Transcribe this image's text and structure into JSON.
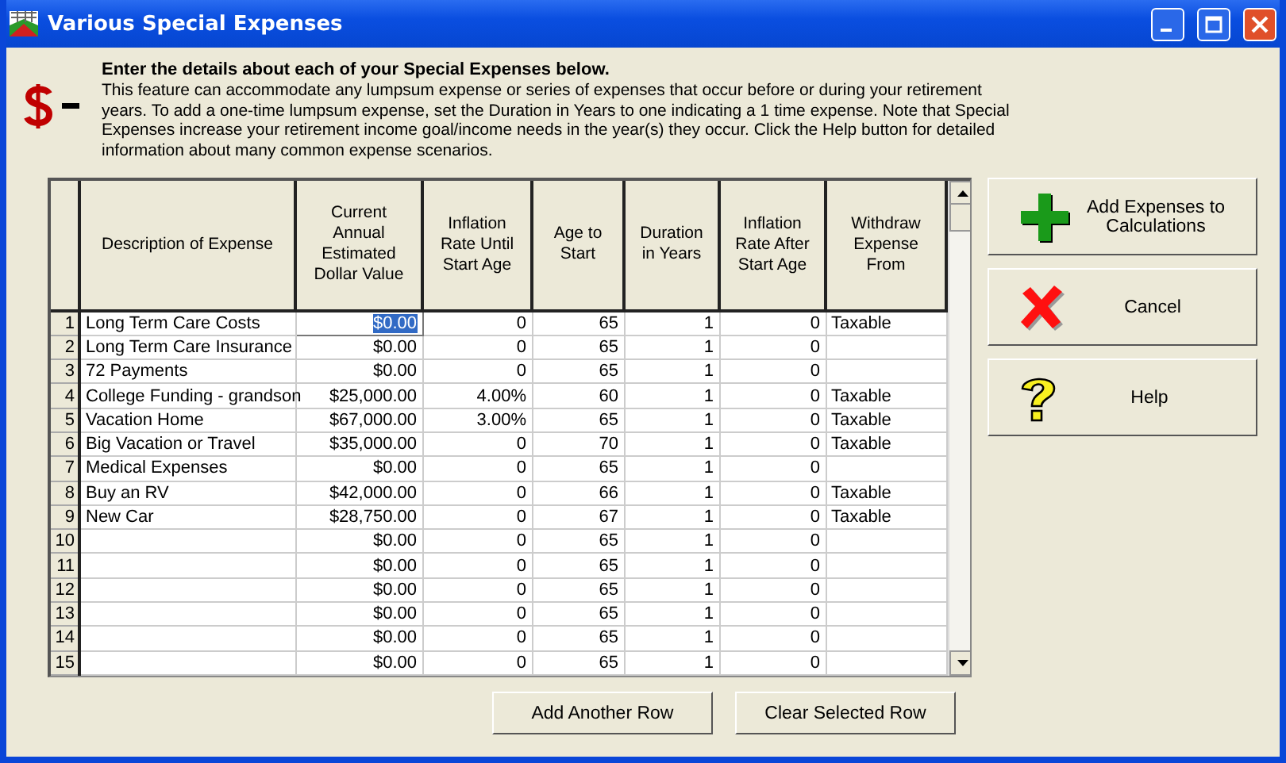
{
  "window": {
    "title": "Various Special Expenses"
  },
  "intro": {
    "heading": "Enter the details about each of your Special Expenses below.",
    "text": "This feature can accommodate any lumpsum expense or series of expenses that occur before or during your retirement years.  To add a one-time lumpsum expense, set the Duration in Years to one indicating a 1 time expense.  Note that Special Expenses increase your retirement income goal/income needs in the year(s) they occur.  Click the Help button for detailed information about many common expense scenarios."
  },
  "table": {
    "columns": [
      "Description of Expense",
      "Current Annual Estimated Dollar Value",
      "Inflation Rate Until Start Age",
      "Age to Start",
      "Duration in Years",
      "Inflation Rate After Start Age",
      "Withdraw Expense From"
    ],
    "rows": [
      {
        "number": "1",
        "description": "Long Term Care Costs",
        "dollar_value": "$0.00",
        "inflation_until_start": "0",
        "age_to_start": "65",
        "duration_years": "1",
        "inflation_after_start": "0",
        "withdraw_from": "Taxable",
        "selected": true
      },
      {
        "number": "2",
        "description": "Long Term Care Insurance",
        "dollar_value": "$0.00",
        "inflation_until_start": "0",
        "age_to_start": "65",
        "duration_years": "1",
        "inflation_after_start": "0",
        "selected": false
      },
      {
        "number": "3",
        "description": "72 Payments",
        "dollar_value": "$0.00",
        "inflation_until_start": "0",
        "age_to_start": "65",
        "duration_years": "1",
        "inflation_after_start": "0",
        "selected": false
      },
      {
        "number": "4",
        "description": "College Funding - grandson",
        "dollar_value": "$25,000.00",
        "inflation_until_start": "4.00%",
        "age_to_start": "60",
        "duration_years": "1",
        "inflation_after_start": "0",
        "withdraw_from": "Taxable",
        "selected": false
      },
      {
        "number": "5",
        "description": "Vacation Home",
        "dollar_value": "$67,000.00",
        "inflation_until_start": "3.00%",
        "age_to_start": "65",
        "duration_years": "1",
        "inflation_after_start": "0",
        "withdraw_from": "Taxable",
        "selected": false
      },
      {
        "number": "6",
        "description": "Big Vacation or Travel",
        "dollar_value": "$35,000.00",
        "inflation_until_start": "0",
        "age_to_start": "70",
        "duration_years": "1",
        "inflation_after_start": "0",
        "withdraw_from": "Taxable",
        "selected": false
      },
      {
        "number": "7",
        "description": "Medical Expenses",
        "dollar_value": "$0.00",
        "inflation_until_start": "0",
        "age_to_start": "65",
        "duration_years": "1",
        "inflation_after_start": "0",
        "selected": false
      },
      {
        "number": "8",
        "description": "Buy an RV",
        "dollar_value": "$42,000.00",
        "inflation_until_start": "0",
        "age_to_start": "66",
        "duration_years": "1",
        "inflation_after_start": "0",
        "withdraw_from": "Taxable",
        "selected": false
      },
      {
        "number": "9",
        "description": "New Car",
        "dollar_value": "$28,750.00",
        "inflation_until_start": "0",
        "age_to_start": "67",
        "duration_years": "1",
        "inflation_after_start": "0",
        "withdraw_from": "Taxable",
        "selected": false
      },
      {
        "number": "10",
        "dollar_value": "$0.00",
        "inflation_until_start": "0",
        "age_to_start": "65",
        "duration_years": "1",
        "inflation_after_start": "0",
        "selected": false
      },
      {
        "number": "11",
        "dollar_value": "$0.00",
        "inflation_until_start": "0",
        "age_to_start": "65",
        "duration_years": "1",
        "inflation_after_start": "0",
        "selected": false
      },
      {
        "number": "12",
        "dollar_value": "$0.00",
        "inflation_until_start": "0",
        "age_to_start": "65",
        "duration_years": "1",
        "inflation_after_start": "0",
        "selected": false
      },
      {
        "number": "13",
        "dollar_value": "$0.00",
        "inflation_until_start": "0",
        "age_to_start": "65",
        "duration_years": "1",
        "inflation_after_start": "0",
        "selected": false
      },
      {
        "number": "14",
        "dollar_value": "$0.00",
        "inflation_until_start": "0",
        "age_to_start": "65",
        "duration_years": "1",
        "inflation_after_start": "0",
        "selected": false
      },
      {
        "number": "15",
        "dollar_value": "$0.00",
        "inflation_until_start": "0",
        "age_to_start": "65",
        "duration_years": "1",
        "inflation_after_start": "0",
        "selected": false
      }
    ]
  },
  "side_buttons": [
    {
      "label": "Add Expenses to Calculations",
      "kind": "add"
    },
    {
      "label": "Cancel",
      "kind": "cancel"
    },
    {
      "label": "Help",
      "kind": "help"
    }
  ],
  "bottom_buttons": [
    "Add Another Row",
    "Clear Selected Row"
  ]
}
